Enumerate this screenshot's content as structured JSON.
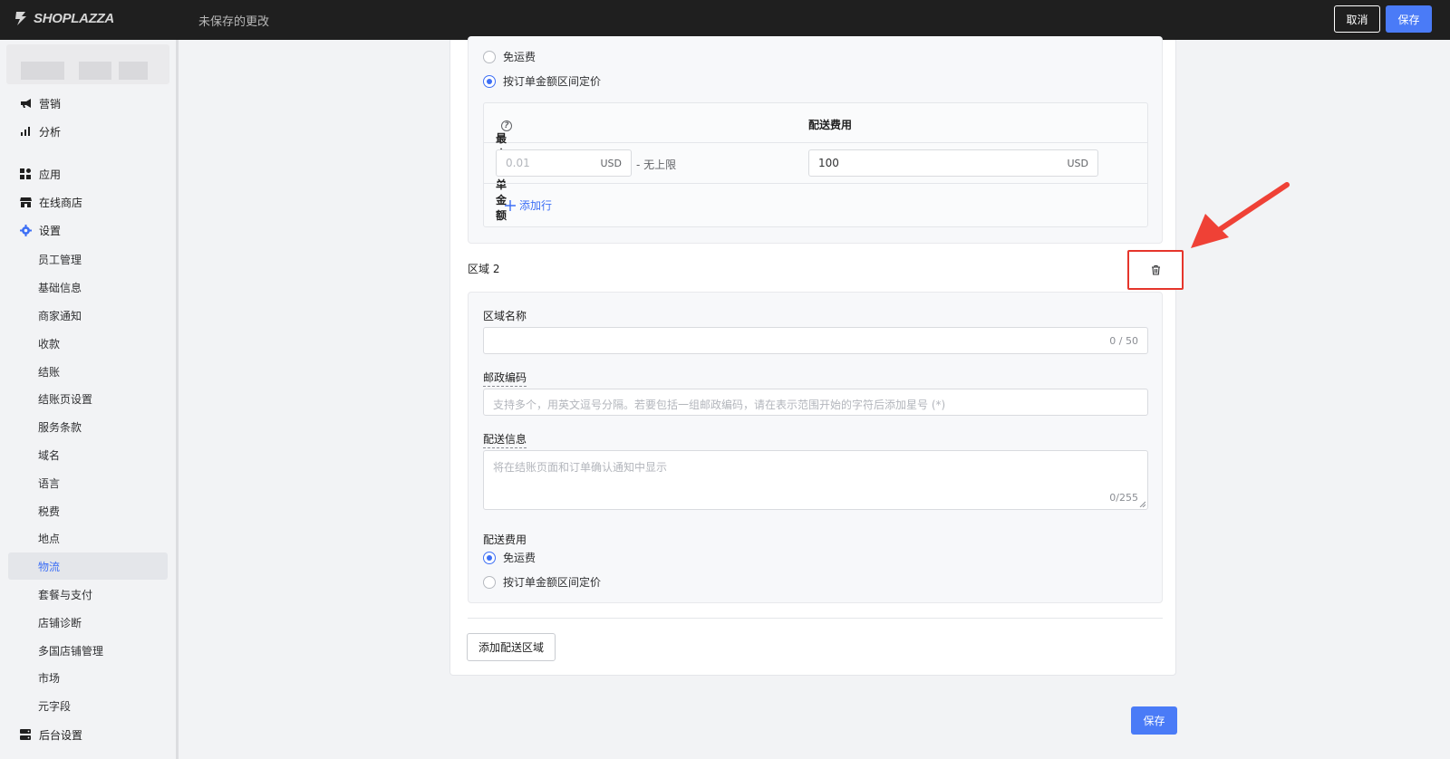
{
  "topbar": {
    "logo": "SHOPLAZZA",
    "unsaved": "未保存的更改",
    "cancel": "取消",
    "save": "保存"
  },
  "sidebar": {
    "main_items": [
      {
        "label": "营销",
        "icon": "megaphone-icon"
      },
      {
        "label": "分析",
        "icon": "bar-chart-icon"
      },
      {
        "label": "应用",
        "icon": "apps-grid-icon"
      },
      {
        "label": "在线商店",
        "icon": "storefront-icon"
      },
      {
        "label": "设置",
        "icon": "gear-icon"
      }
    ],
    "settings_items": [
      "员工管理",
      "基础信息",
      "商家通知",
      "收款",
      "结账",
      "结账页设置",
      "服务条款",
      "域名",
      "语言",
      "税费",
      "地点",
      "物流",
      "套餐与支付",
      "店铺诊断",
      "多国店铺管理",
      "市场",
      "元字段"
    ],
    "active_item": "物流",
    "bottom_item": {
      "label": "后台设置",
      "icon": "server-icon"
    },
    "accent_color": "#3d6ff5"
  },
  "zone1": {
    "options": [
      "免运费",
      "按订单金额区间定价"
    ],
    "selected": "按订单金额区间定价",
    "table": {
      "col_min": "最小订单金额",
      "col_fee": "配送费用",
      "min_placeholder": "0.01",
      "min_suffix": "USD",
      "no_limit": "- 无上限",
      "fee_value": "100",
      "fee_suffix": "USD",
      "add_row": "添加行"
    }
  },
  "zone2": {
    "title": "区域 2",
    "name_label": "区域名称",
    "name_counter": "0 / 50",
    "postal_label": "邮政编码",
    "postal_placeholder": "支持多个，用英文逗号分隔。若要包括一组邮政编码，请在表示范围开始的字符后添加星号 (*)",
    "info_label": "配送信息",
    "info_placeholder": "将在结账页面和订单确认通知中显示",
    "info_counter": "0/255",
    "fee_label": "配送费用",
    "options": [
      "免运费",
      "按订单金额区间定价"
    ],
    "selected": "免运费"
  },
  "add_zone": "添加配送区域",
  "save_bottom": "保存",
  "highlight_color": "#e5352b"
}
